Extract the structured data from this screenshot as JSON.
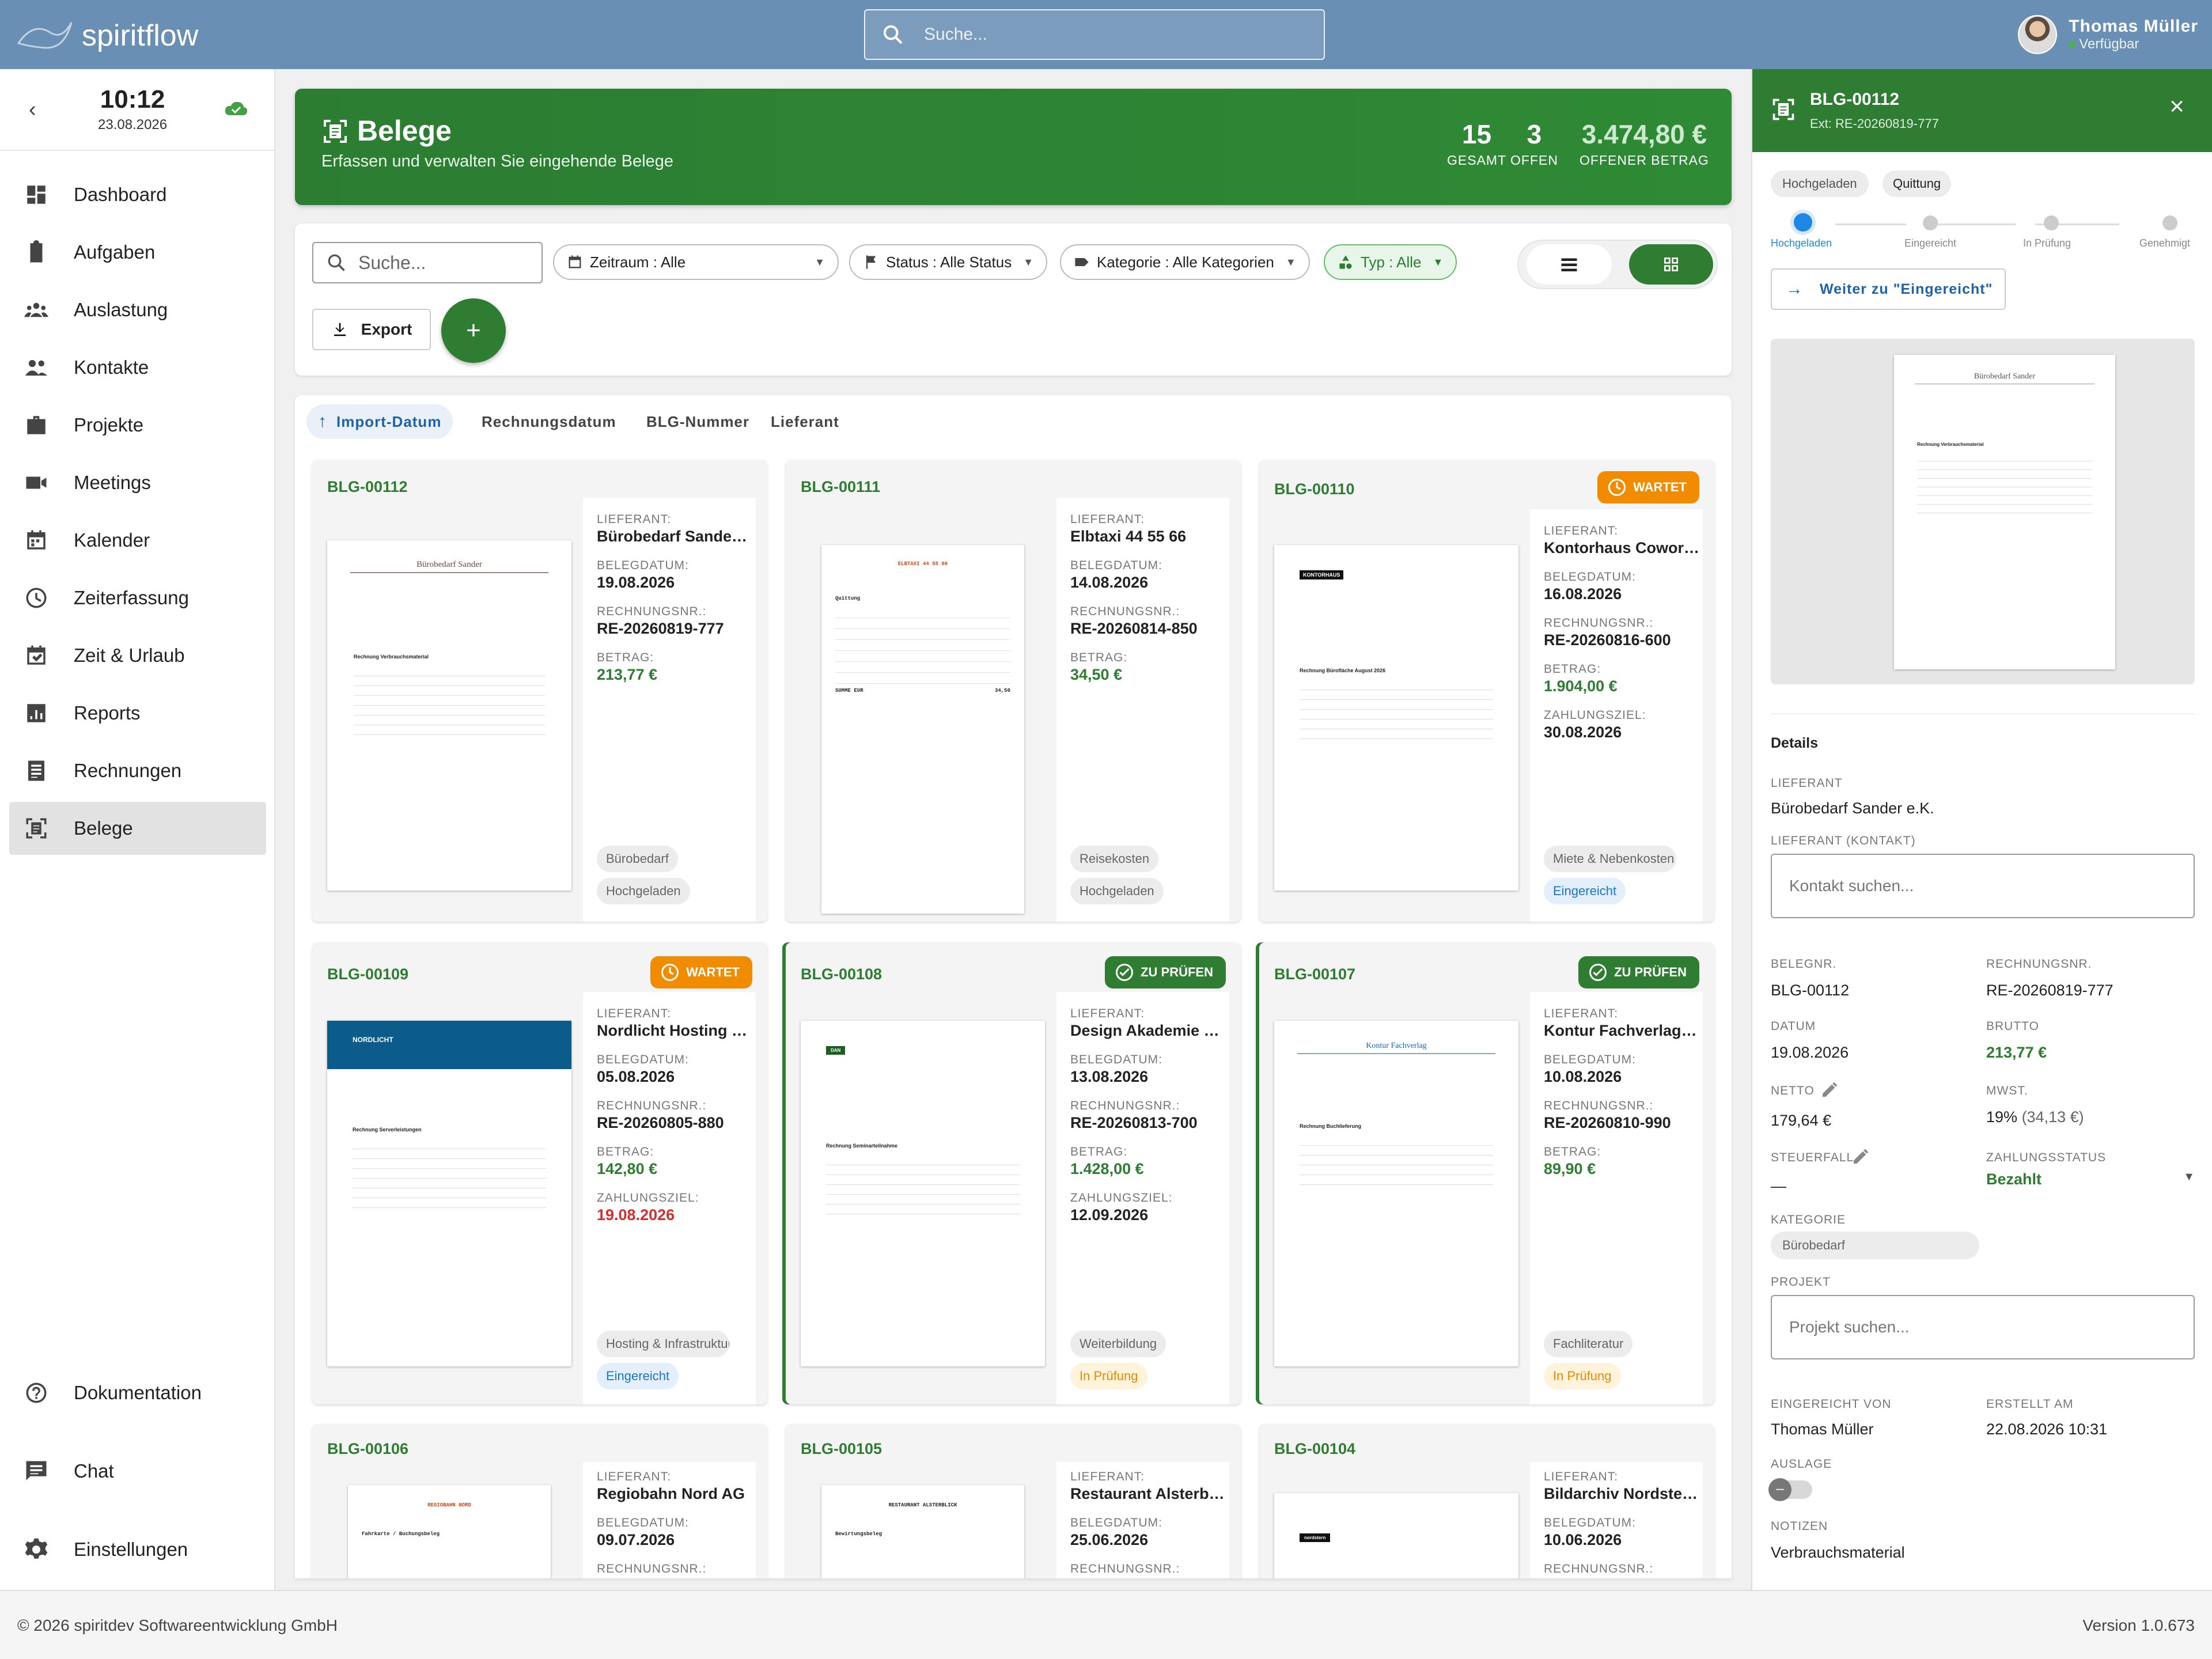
{
  "app": {
    "name": "spiritflow",
    "search_placeholder": "Suche..."
  },
  "user": {
    "name": "Thomas Müller",
    "status": "Verfügbar"
  },
  "clock": {
    "time": "10:12",
    "date": "23.08.2026"
  },
  "nav": [
    "Dashboard",
    "Aufgaben",
    "Auslastung",
    "Kontakte",
    "Projekte",
    "Meetings",
    "Kalender",
    "Zeiterfassung",
    "Zeit & Urlaub",
    "Reports",
    "Rechnungen",
    "Belege"
  ],
  "nav_bottom": [
    "Dokumentation",
    "Chat",
    "Einstellungen"
  ],
  "hero": {
    "title": "Belege",
    "subtitle": "Erfassen und verwalten Sie eingehende Belege",
    "total": "15",
    "total_label": "GESAMT",
    "open": "3",
    "open_label": "OFFEN",
    "amount": "3.474,80 €",
    "amount_label": "OFFENER BETRAG"
  },
  "toolbar": {
    "search_placeholder": "Suche...",
    "zeitraum": "Zeitraum : Alle",
    "status": "Status : Alle Status",
    "kategorie": "Kategorie : Alle Kategorien",
    "typ": "Typ : Alle",
    "export": "Export",
    "add": "+"
  },
  "sort_tabs": [
    "Import-Datum",
    "Rechnungsdatum",
    "BLG-Nummer",
    "Lieferant"
  ],
  "labels": {
    "supplier": "LIEFERANT:",
    "date": "BELEGDATUM:",
    "invno": "RECHNUNGSNR.:",
    "amount": "BETRAG:",
    "due": "ZAHLUNGSZIEL:"
  },
  "cards": [
    {
      "id": "BLG-00112",
      "supplier": "Bürobedarf Sander e.K.",
      "date": "19.08.2026",
      "invno": "RE-20260819-777",
      "amount": "213,77 €",
      "due": "",
      "badge": "",
      "category": "Bürobedarf",
      "status": "Hochgeladen"
    },
    {
      "id": "BLG-00111",
      "supplier": "Elbtaxi 44 55 66",
      "date": "14.08.2026",
      "invno": "RE-20260814-850",
      "amount": "34,50 €",
      "due": "",
      "badge": "",
      "category": "Reisekosten",
      "status": "Hochgeladen"
    },
    {
      "id": "BLG-00110",
      "supplier": "Kontorhaus Coworking GmbH",
      "date": "16.08.2026",
      "invno": "RE-20260816-600",
      "amount": "1.904,00 €",
      "due": "30.08.2026",
      "badge": "WARTET",
      "category": "Miete & Nebenkosten",
      "status": "Eingereicht"
    },
    {
      "id": "BLG-00109",
      "supplier": "Nordlicht Hosting GmbH",
      "date": "05.08.2026",
      "invno": "RE-20260805-880",
      "amount": "142,80 €",
      "due": "19.08.2026",
      "badge": "WARTET",
      "category": "Hosting & Infrastruktur",
      "status": "Eingereicht"
    },
    {
      "id": "BLG-00108",
      "supplier": "Design Akademie Nord",
      "date": "13.08.2026",
      "invno": "RE-20260813-700",
      "amount": "1.428,00 €",
      "due": "12.09.2026",
      "badge": "ZU PRÜFEN",
      "category": "Weiterbildung",
      "status": "In Prüfung"
    },
    {
      "id": "BLG-00107",
      "supplier": "Kontur Fachverlag GmbH",
      "date": "10.08.2026",
      "invno": "RE-20260810-990",
      "amount": "89,90 €",
      "due": "",
      "badge": "ZU PRÜFEN",
      "category": "Fachliteratur",
      "status": "In Prüfung"
    },
    {
      "id": "BLG-00106",
      "supplier": "Regiobahn Nord AG",
      "date": "09.07.2026",
      "invno": "",
      "amount": "",
      "due": "",
      "badge": "",
      "category": "",
      "status": ""
    },
    {
      "id": "BLG-00105",
      "supplier": "Restaurant Alsterblick",
      "date": "25.06.2026",
      "invno": "",
      "amount": "",
      "due": "",
      "badge": "",
      "category": "",
      "status": ""
    },
    {
      "id": "BLG-00104",
      "supplier": "Bildarchiv Nordstern GmbH",
      "date": "10.06.2026",
      "invno": "",
      "amount": "",
      "due": "",
      "badge": "",
      "category": "",
      "status": ""
    }
  ],
  "docs": {
    "d1": "Bürobedarf Sander",
    "d1b": "Rechnung Verbrauchsmaterial",
    "d2": "ELBTAXI 44 55 66",
    "d2a": "Quittung",
    "d2b": "SUMME EUR",
    "d2c": "34,50",
    "d3": "KONTORHAUS",
    "d3b": "Rechnung Bürofläche August 2026",
    "d4": "NORDLICHT",
    "d4b": "Rechnung Serverleistungen",
    "d5": "DAN",
    "d5b": "Rechnung Seminarteilnahme",
    "d6": "Kontur Fachverlag",
    "d6b": "Rechnung Buchlieferung",
    "d7": "REGIOBAHN NORD",
    "d7b": "Fahrkarte / Buchungsbeleg",
    "d8": "RESTAURANT ALSTERBLICK",
    "d8b": "Bewirtungsbeleg",
    "d9": "nordstern"
  },
  "detail": {
    "id": "BLG-00112",
    "ext": "Ext: RE-20260819-777",
    "tags": [
      "Hochgeladen",
      "Quittung"
    ],
    "steps": [
      "Hochgeladen",
      "Eingereicht",
      "In Prüfung",
      "Genehmigt"
    ],
    "next": "Weiter zu \"Eingereicht\"",
    "section": "Details",
    "supplier_label": "LIEFERANT",
    "supplier": "Bürobedarf Sander e.K.",
    "contact_label": "LIEFERANT (KONTAKT)",
    "contact_placeholder": "Kontakt suchen...",
    "belegnr_label": "BELEGNR.",
    "belegnr": "BLG-00112",
    "rechnr_label": "RECHNUNGSNR.",
    "rechnr": "RE-20260819-777",
    "datum_label": "DATUM",
    "datum": "19.08.2026",
    "brutto_label": "BRUTTO",
    "brutto": "213,77 €",
    "netto_label": "NETTO",
    "netto": "179,64 €",
    "mwst_label": "MWST.",
    "mwst": "19%",
    "mwst_amount": "(34,13 €)",
    "steuer_label": "STEUERFALL",
    "steuer": "—",
    "zahl_label": "ZAHLUNGSSTATUS",
    "zahl": "Bezahlt",
    "kat_label": "KATEGORIE",
    "kat": "Bürobedarf",
    "projekt_label": "PROJEKT",
    "projekt_placeholder": "Projekt suchen...",
    "von_label": "EINGEREICHT VON",
    "von": "Thomas Müller",
    "erstellt_label": "ERSTELLT AM",
    "erstellt": "22.08.2026 10:31",
    "auslage_label": "AUSLAGE",
    "notiz_label": "NOTIZEN",
    "notiz": "Verbrauchsmaterial"
  },
  "footer": {
    "copyright": "© 2026 spiritdev Softwareentwicklung GmbH",
    "version": "Version 1.0.673"
  }
}
